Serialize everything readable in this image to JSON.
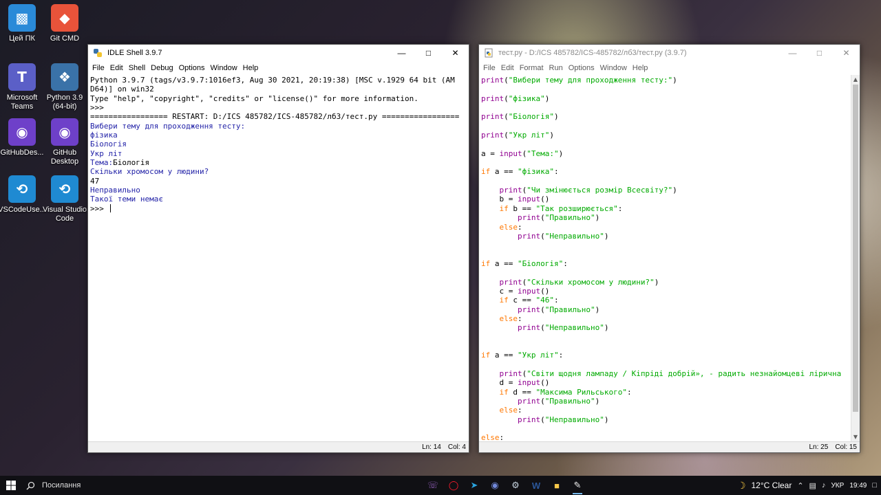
{
  "desktop": {
    "icons": [
      {
        "label": "Цей ПК",
        "icon": "this-pc-icon"
      },
      {
        "label": "Git CMD",
        "icon": "git-icon"
      },
      {
        "label": "Microsoft Teams",
        "icon": "teams-icon"
      },
      {
        "label": "Python 3.9 (64-bit)",
        "icon": "python-icon"
      },
      {
        "label": "GitHubDes...",
        "icon": "github-icon"
      },
      {
        "label": "GitHub Desktop",
        "icon": "github-icon"
      },
      {
        "label": "VSCodeUse...",
        "icon": "vscode-icon"
      },
      {
        "label": "Visual Studio Code",
        "icon": "vscode-icon"
      }
    ]
  },
  "shell_window": {
    "title": "IDLE Shell 3.9.7",
    "menu": [
      "File",
      "Edit",
      "Shell",
      "Debug",
      "Options",
      "Window",
      "Help"
    ],
    "lines": [
      {
        "text": "Python 3.9.7 (tags/v3.9.7:1016ef3, Aug 30 2021, 20:19:38) [MSC v.1929 64 bit (AM",
        "style": "black"
      },
      {
        "text": "D64)] on win32",
        "style": "black"
      },
      {
        "text": "Type \"help\", \"copyright\", \"credits\" or \"license()\" for more information.",
        "style": "black"
      },
      {
        "text": ">>> ",
        "style": "black"
      },
      {
        "text": "================= RESTART: D:/ICS 485782/ICS-485782/лб3/тест.py =================",
        "style": "black"
      },
      {
        "text": "Вибери тему для проходження тесту:",
        "style": "out"
      },
      {
        "text": "фізика",
        "style": "out"
      },
      {
        "text": "Біологія",
        "style": "out"
      },
      {
        "text": "Укр літ",
        "style": "out"
      },
      {
        "text": "Тема:Біологія",
        "style": "mixed",
        "prompt": "Тема:",
        "input": "Біологія"
      },
      {
        "text": "Скільки хромосом у людини?",
        "style": "out"
      },
      {
        "text": "47",
        "style": "black"
      },
      {
        "text": "Неправильно",
        "style": "out"
      },
      {
        "text": "Такої теми немає",
        "style": "out"
      }
    ],
    "prompt_line": ">>> ",
    "status": {
      "ln": "Ln: 14",
      "col": "Col: 4"
    }
  },
  "editor_window": {
    "title": "тест.py - D:/ICS 485782/ICS-485782/лб3/тест.py (3.9.7)",
    "menu": [
      "File",
      "Edit",
      "Format",
      "Run",
      "Options",
      "Window",
      "Help"
    ],
    "status": {
      "ln": "Ln: 25",
      "col": "Col: 15"
    },
    "code": [
      [
        [
          "bi",
          "print"
        ],
        [
          "n",
          "("
        ],
        [
          "str",
          "\"Вибери тему для проходження тесту:\""
        ],
        [
          "n",
          ")"
        ]
      ],
      [],
      [
        [
          "bi",
          "print"
        ],
        [
          "n",
          "("
        ],
        [
          "str",
          "\"фізика\""
        ],
        [
          "n",
          ")"
        ]
      ],
      [],
      [
        [
          "bi",
          "print"
        ],
        [
          "n",
          "("
        ],
        [
          "str",
          "\"Біологія\""
        ],
        [
          "n",
          ")"
        ]
      ],
      [],
      [
        [
          "bi",
          "print"
        ],
        [
          "n",
          "("
        ],
        [
          "str",
          "\"Укр літ\""
        ],
        [
          "n",
          ")"
        ]
      ],
      [],
      [
        [
          "n",
          "a = "
        ],
        [
          "bi",
          "input"
        ],
        [
          "n",
          "("
        ],
        [
          "str",
          "\"Тема:\""
        ],
        [
          "n",
          ")"
        ]
      ],
      [],
      [
        [
          "kw",
          "if"
        ],
        [
          "n",
          " a == "
        ],
        [
          "str",
          "\"фізика\""
        ],
        [
          "n",
          ":"
        ]
      ],
      [],
      [
        [
          "n",
          "    "
        ],
        [
          "bi",
          "print"
        ],
        [
          "n",
          "("
        ],
        [
          "str",
          "\"Чи змінюється розмір Всесвіту?\""
        ],
        [
          "n",
          ")"
        ]
      ],
      [
        [
          "n",
          "    b = "
        ],
        [
          "bi",
          "input"
        ],
        [
          "n",
          "()"
        ]
      ],
      [
        [
          "n",
          "    "
        ],
        [
          "kw",
          "if"
        ],
        [
          "n",
          " b == "
        ],
        [
          "str",
          "\"Так розширюється\""
        ],
        [
          "n",
          ":"
        ]
      ],
      [
        [
          "n",
          "        "
        ],
        [
          "bi",
          "print"
        ],
        [
          "n",
          "("
        ],
        [
          "str",
          "\"Правильно\""
        ],
        [
          "n",
          ")"
        ]
      ],
      [
        [
          "n",
          "    "
        ],
        [
          "kw",
          "else"
        ],
        [
          "n",
          ":"
        ]
      ],
      [
        [
          "n",
          "        "
        ],
        [
          "bi",
          "print"
        ],
        [
          "n",
          "("
        ],
        [
          "str",
          "\"Неправильно\""
        ],
        [
          "n",
          ")"
        ]
      ],
      [],
      [],
      [
        [
          "kw",
          "if"
        ],
        [
          "n",
          " a == "
        ],
        [
          "str",
          "\"Біологія\""
        ],
        [
          "n",
          ":"
        ]
      ],
      [],
      [
        [
          "n",
          "    "
        ],
        [
          "bi",
          "print"
        ],
        [
          "n",
          "("
        ],
        [
          "str",
          "\"Скільки хромосом у людини?\""
        ],
        [
          "n",
          ")"
        ]
      ],
      [
        [
          "n",
          "    c = "
        ],
        [
          "bi",
          "input"
        ],
        [
          "n",
          "()"
        ]
      ],
      [
        [
          "n",
          "    "
        ],
        [
          "kw",
          "if"
        ],
        [
          "n",
          " c == "
        ],
        [
          "str",
          "\"46\""
        ],
        [
          "n",
          ":"
        ]
      ],
      [
        [
          "n",
          "        "
        ],
        [
          "bi",
          "print"
        ],
        [
          "n",
          "("
        ],
        [
          "str",
          "\"Правильно\""
        ],
        [
          "n",
          ")"
        ]
      ],
      [
        [
          "n",
          "    "
        ],
        [
          "kw",
          "else"
        ],
        [
          "n",
          ":"
        ]
      ],
      [
        [
          "n",
          "        "
        ],
        [
          "bi",
          "print"
        ],
        [
          "n",
          "("
        ],
        [
          "str",
          "\"Неправильно\""
        ],
        [
          "n",
          ")"
        ]
      ],
      [],
      [],
      [
        [
          "kw",
          "if"
        ],
        [
          "n",
          " a == "
        ],
        [
          "str",
          "\"Укр літ\""
        ],
        [
          "n",
          ":"
        ]
      ],
      [],
      [
        [
          "n",
          "    "
        ],
        [
          "bi",
          "print"
        ],
        [
          "n",
          "("
        ],
        [
          "str",
          "\"Світи щодня лампаду / Кіпріді добрій», - радить незнайомцеві лірична"
        ]
      ],
      [
        [
          "n",
          "    d = "
        ],
        [
          "bi",
          "input"
        ],
        [
          "n",
          "()"
        ]
      ],
      [
        [
          "n",
          "    "
        ],
        [
          "kw",
          "if"
        ],
        [
          "n",
          " d == "
        ],
        [
          "str",
          "\"Максима Рильського\""
        ],
        [
          "n",
          ":"
        ]
      ],
      [
        [
          "n",
          "        "
        ],
        [
          "bi",
          "print"
        ],
        [
          "n",
          "("
        ],
        [
          "str",
          "\"Правильно\""
        ],
        [
          "n",
          ")"
        ]
      ],
      [
        [
          "n",
          "    "
        ],
        [
          "kw",
          "else"
        ],
        [
          "n",
          ":"
        ]
      ],
      [
        [
          "n",
          "        "
        ],
        [
          "bi",
          "print"
        ],
        [
          "n",
          "("
        ],
        [
          "str",
          "\"Неправильно\""
        ],
        [
          "n",
          ")"
        ]
      ],
      [],
      [
        [
          "kw",
          "else"
        ],
        [
          "n",
          ":"
        ]
      ]
    ]
  },
  "taskbar": {
    "search_label": "Посилання",
    "weather": "12°C  Clear",
    "language": "УКР",
    "time": "19:49"
  },
  "colors": {
    "keyword": "#ff7700",
    "builtin": "#900090",
    "string": "#00aa00",
    "shell_output": "#2323a8",
    "taskbar_bg": "#101014"
  }
}
